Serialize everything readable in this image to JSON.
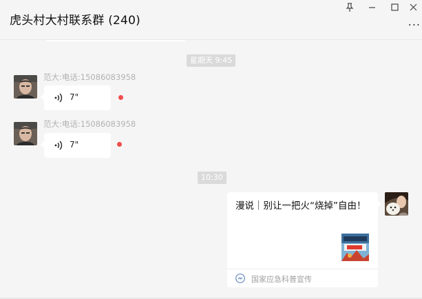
{
  "window": {
    "title": "虎头村大村联系群 (240)",
    "pin_icon": "pin-icon",
    "minimize_icon": "minimize-icon",
    "maximize_icon": "maximize-icon",
    "close_icon": "close-icon",
    "more_label": "..."
  },
  "chat": {
    "time_1": "星期天 9:45",
    "messages": [
      {
        "sender": "范大:电话:15086083958",
        "type": "voice",
        "duration": "7\"",
        "unread": true
      },
      {
        "sender": "范大:电话:15086083958",
        "type": "voice",
        "duration": "7\"",
        "unread": true
      }
    ],
    "time_2": "10:30",
    "card": {
      "title": "漫说｜别让一把火“烧掉”自由！",
      "source": "国家应急科普宣传"
    }
  },
  "colors": {
    "background": "#f5f5f5",
    "bubble": "#ffffff",
    "unread_dot": "#f04d4d",
    "time_pill": "#dadada"
  }
}
